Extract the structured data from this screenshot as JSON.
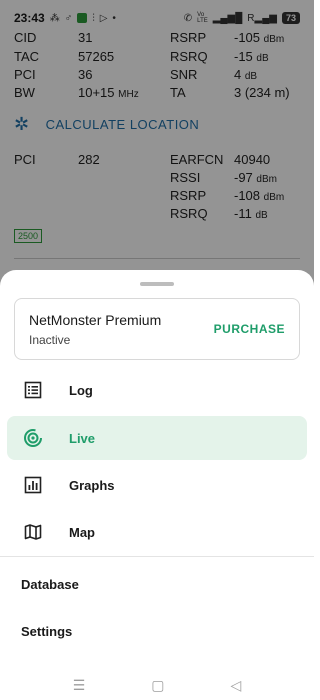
{
  "status_bar": {
    "time": "23:43",
    "icons_left": [
      "network-icon",
      "bluetooth-icon",
      "app-icon",
      "signal-icon",
      "play-icon",
      "dot-icon"
    ],
    "icons_right": [
      "wifi-calling-icon",
      "volte-icon",
      "signal-bars-icon",
      "signal-bars-r-icon"
    ],
    "volte_label": "Vo\nLTE",
    "battery": "73"
  },
  "background": {
    "rows_top": [
      {
        "label": "CID",
        "value": "31",
        "label2": "RSRP",
        "value2": "-105",
        "unit2": "dBm"
      },
      {
        "label": "TAC",
        "value": "57265",
        "label2": "RSRQ",
        "value2": "-15",
        "unit2": "dB"
      },
      {
        "label": "PCI",
        "value": "36",
        "label2": "SNR",
        "value2": "4",
        "unit2": "dB"
      },
      {
        "label": "BW",
        "value": "10+15",
        "unit": "MHz",
        "label2": "TA",
        "value2": "3 (234 m)",
        "unit2": ""
      }
    ],
    "calc_label": "CALCULATE LOCATION",
    "neighbor": {
      "label": "PCI",
      "value": "282",
      "rows": [
        {
          "label": "EARFCN",
          "value": "40940",
          "unit": ""
        },
        {
          "label": "RSSI",
          "value": "-97",
          "unit": "dBm"
        },
        {
          "label": "RSRP",
          "value": "-108",
          "unit": "dBm"
        },
        {
          "label": "RSRQ",
          "value": "-11",
          "unit": "dB"
        }
      ]
    },
    "band_badge": "2500"
  },
  "sheet": {
    "premium": {
      "title": "NetMonster Premium",
      "status": "Inactive",
      "action": "PURCHASE"
    },
    "menu": [
      {
        "label": "Log",
        "icon": "list-icon",
        "active": false
      },
      {
        "label": "Live",
        "icon": "live-radar-icon",
        "active": true
      },
      {
        "label": "Graphs",
        "icon": "bar-chart-icon",
        "active": false
      },
      {
        "label": "Map",
        "icon": "map-icon",
        "active": false
      }
    ],
    "extra": [
      "Database",
      "Settings"
    ]
  },
  "nav_bar": [
    "menu-nav-icon",
    "home-nav-icon",
    "back-nav-icon"
  ],
  "colors": {
    "accent": "#1f9d6a",
    "link": "#1f6fa8",
    "active_bg": "#e4f3ea"
  }
}
